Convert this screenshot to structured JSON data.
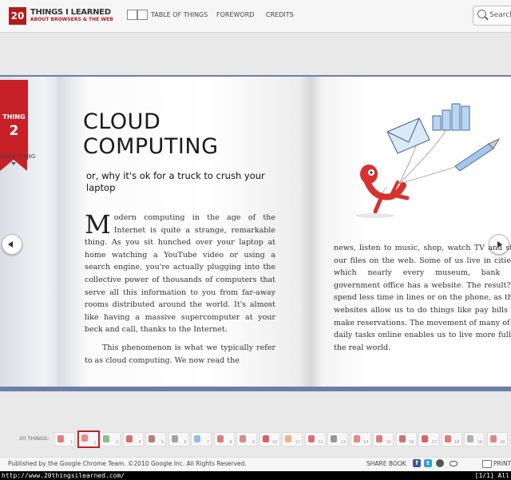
{
  "header": {
    "logo_number": "20",
    "logo_title": "THINGS I LEARNED",
    "logo_subtitle": "ABOUT BROWSERS & THE WEB",
    "nav": [
      "TABLE OF THINGS",
      "FOREWORD",
      "CREDITS"
    ],
    "search_label": "Search"
  },
  "chapter": {
    "ribbon_label": "THING",
    "ribbon_number": "2",
    "share_label": "SHARE THING",
    "title_line1": "CLOUD",
    "title_line2": "COMPUTING",
    "subtitle": "or, why it's ok for a truck to crush your laptop",
    "drop_cap": "M",
    "para1": "odern computing in the age of the Internet is quite a strange, remarkable thing. As you sit hunched over your laptop at home watching a YouTube video or using a search engine, you're actually plugging into the collective power of thousands of computers that serve all this information to you from far-away rooms distributed around the world. It's almost like having a massive supercomputer at your beck and call, thanks to the Internet.",
    "para2": "This phenomenon is what we typically refer to as cloud computing. We now read the",
    "right_column": "news, listen to music, shop, watch TV and store our files on the web. Some of us live in cities in which nearly every museum, bank and government office has a website. The result? We spend less time in lines or on the phone, as these websites allow us to do things like pay bills and make reservations. The movement of many of our daily tasks online enables us to live more fully in the real world."
  },
  "strip": {
    "label": "20 THINGS:",
    "pages": [
      "1",
      "2",
      "3",
      "4",
      "5",
      "6",
      "7",
      "8",
      "9",
      "10",
      "11",
      "12",
      "13",
      "14",
      "15",
      "16",
      "17",
      "18",
      "19",
      "20"
    ],
    "selected_index": 1,
    "thumb_colors": [
      "#d55",
      "#e66",
      "#6a6",
      "#c44",
      "#a55",
      "#888",
      "#7ac",
      "#c55",
      "#c66",
      "#c33",
      "#e96",
      "#c44",
      "#777",
      "#d66",
      "#c55",
      "#b44",
      "#c33",
      "#c55",
      "#999",
      "#c66"
    ]
  },
  "footer": {
    "publisher": "Published by the Google Chrome Team. ©2010 Google Inc. All Rights Reserved.",
    "share_book": "SHARE BOOK",
    "print": "PRINT"
  },
  "statusbar": {
    "url": "http://www.20thingsilearned.com/",
    "position": "[1/1] All"
  }
}
